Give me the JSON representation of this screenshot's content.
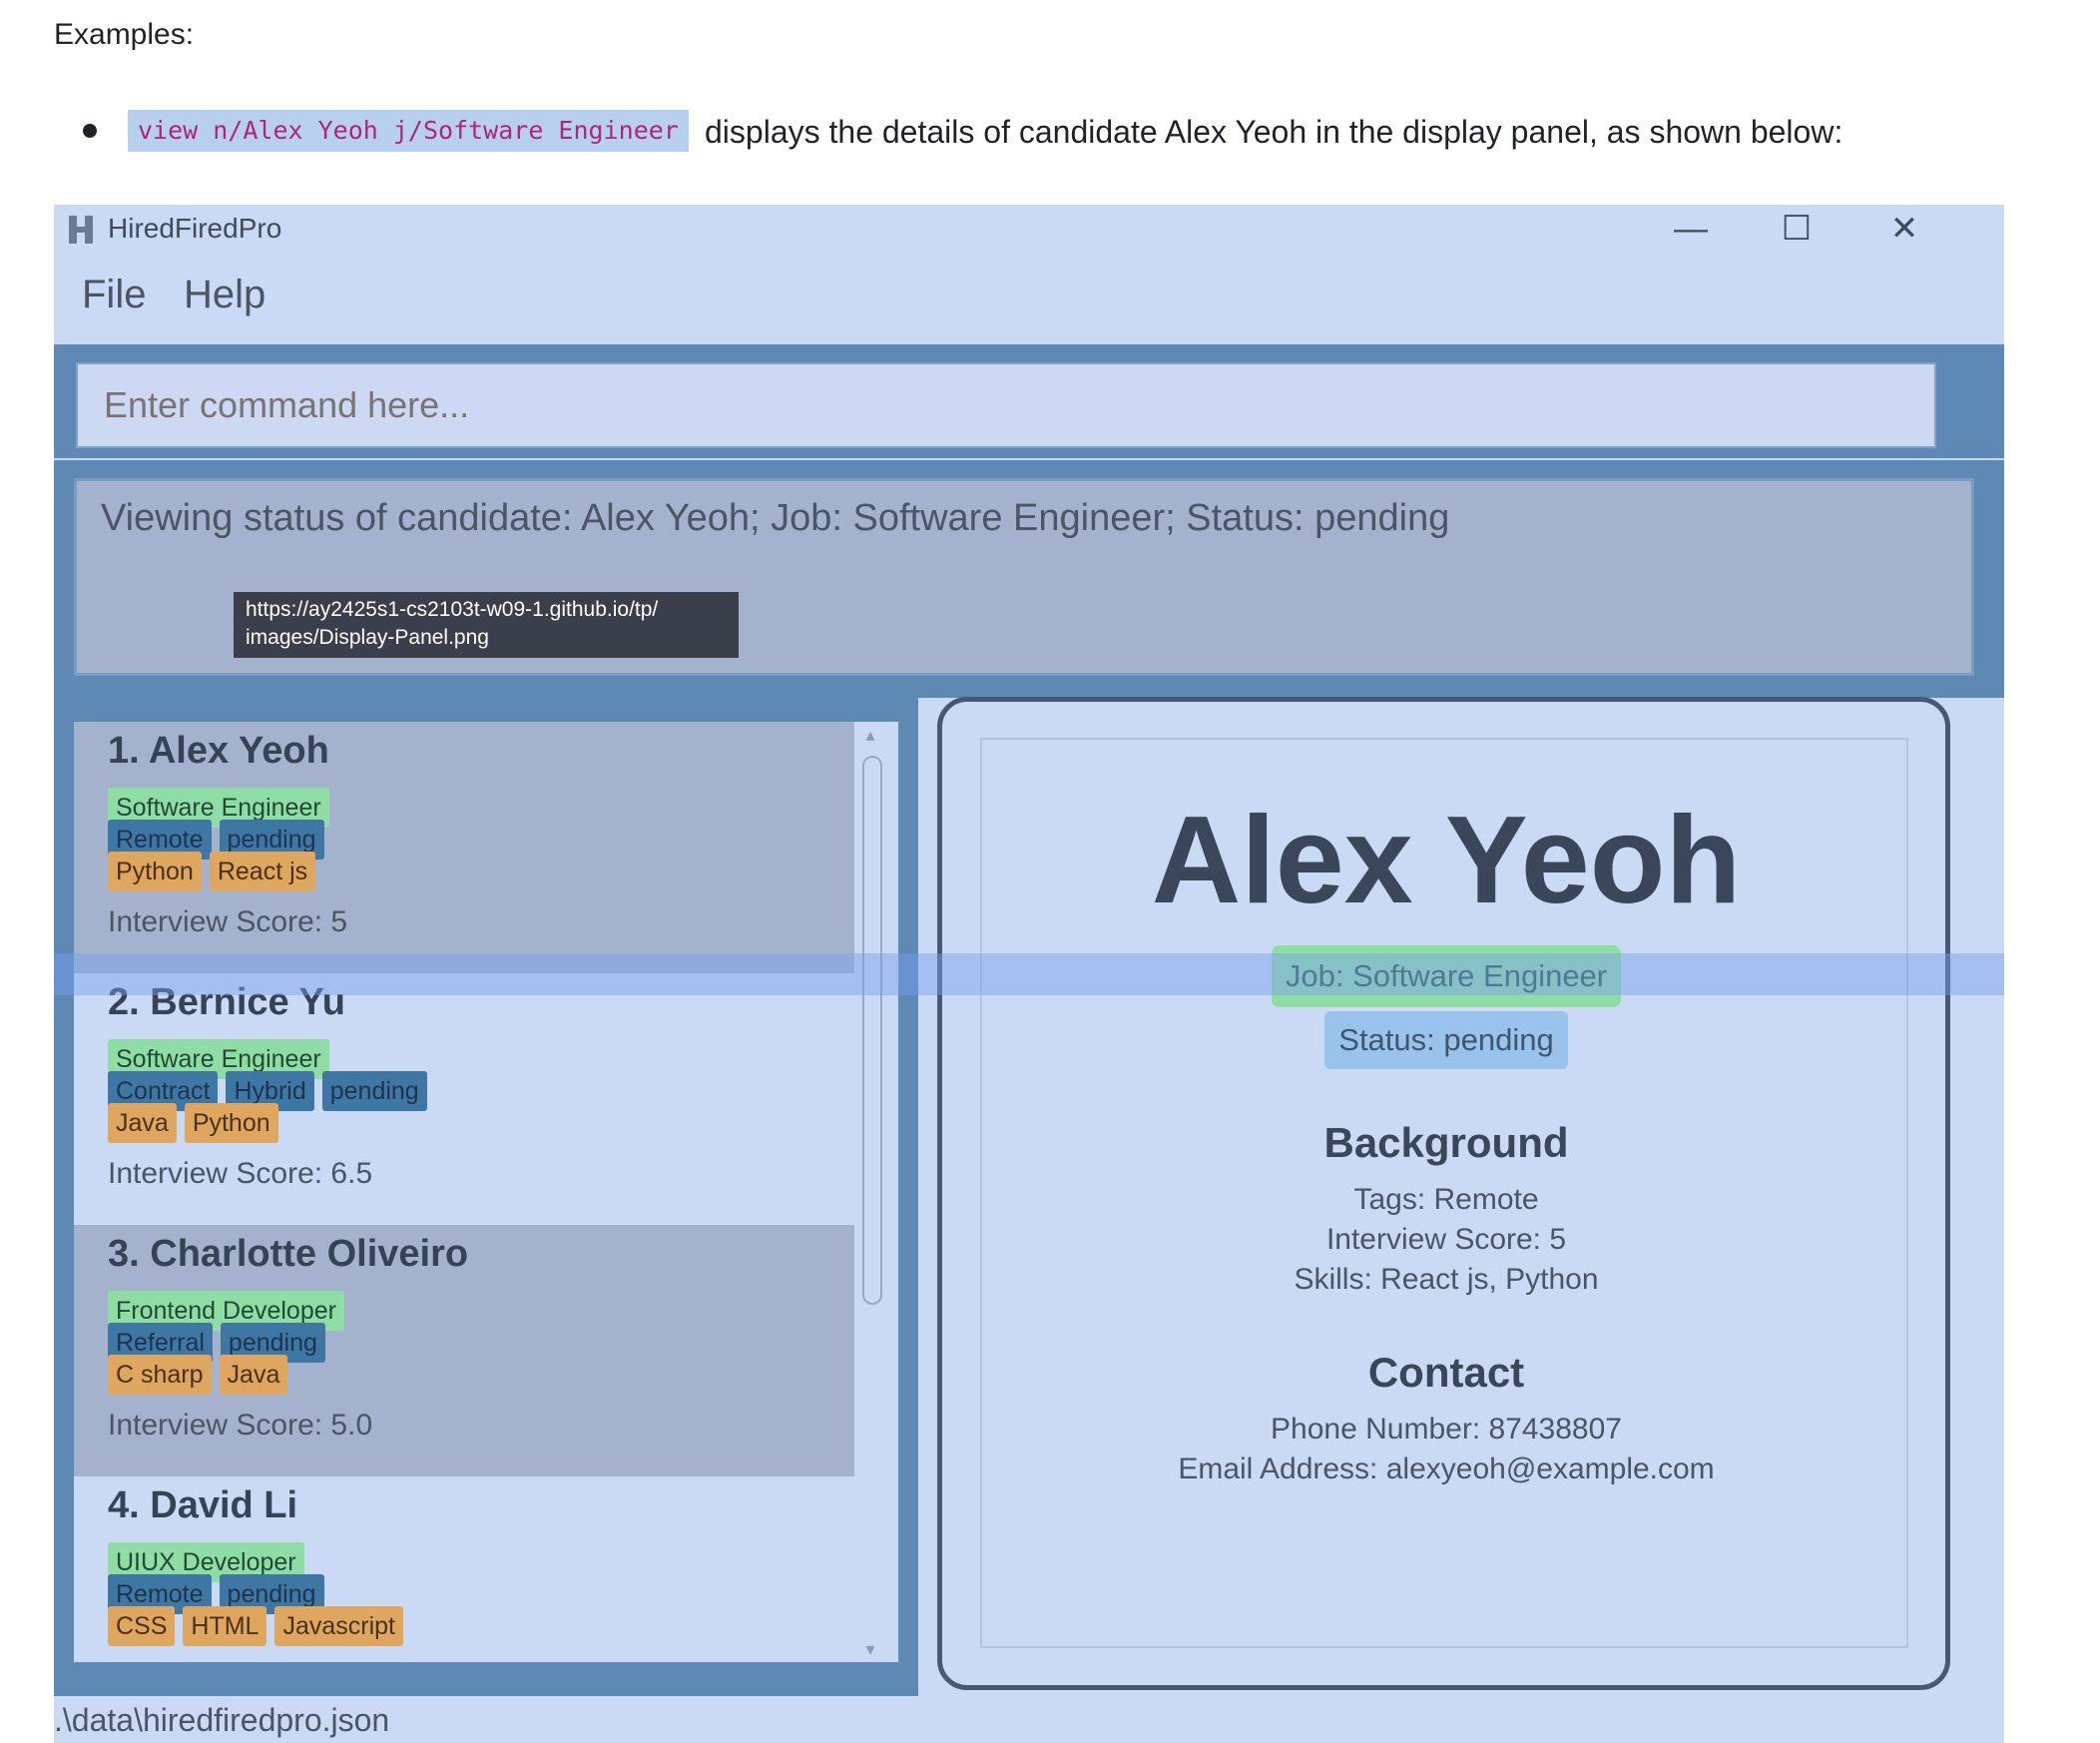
{
  "doc": {
    "heading": "Examples:",
    "code": "view n/Alex Yeoh j/Software Engineer",
    "sentence": "displays the details of candidate Alex Yeoh in the display panel, as shown below:"
  },
  "window": {
    "title": "HiredFiredPro",
    "minimize_glyph": "—",
    "maximize_glyph": "☐",
    "close_glyph": "✕"
  },
  "menu": {
    "file": "File",
    "help": "Help"
  },
  "command": {
    "placeholder": "Enter command here..."
  },
  "result": {
    "text": "Viewing status of candidate: Alex Yeoh; Job: Software Engineer; Status: pending"
  },
  "tooltip": {
    "line1": "https://ay2425s1-cs2103t-w09-1.github.io/tp/",
    "line2": "images/Display-Panel.png"
  },
  "candidates": [
    {
      "name": "1. Alex Yeoh",
      "job": "Software Engineer",
      "tags": [
        "Remote",
        "pending"
      ],
      "skills": [
        "Python",
        "React js"
      ],
      "score": "Interview Score: 5"
    },
    {
      "name": "2. Bernice Yu",
      "job": "Software Engineer",
      "tags": [
        "Contract",
        "Hybrid",
        "pending"
      ],
      "skills": [
        "Java",
        "Python"
      ],
      "score": "Interview Score: 6.5"
    },
    {
      "name": "3. Charlotte Oliveiro",
      "job": "Frontend Developer",
      "tags": [
        "Referral",
        "pending"
      ],
      "skills": [
        "C sharp",
        "Java"
      ],
      "score": "Interview Score: 5.0"
    },
    {
      "name": "4. David Li",
      "job": "UIUX Developer",
      "tags": [
        "Remote",
        "pending"
      ],
      "skills": [
        "CSS",
        "HTML",
        "Javascript"
      ],
      "score": ""
    }
  ],
  "display": {
    "name": "Alex Yeoh",
    "job": "Job: Software Engineer",
    "status": "Status: pending",
    "background_heading": "Background",
    "tags": "Tags: Remote",
    "score": "Interview Score: 5",
    "skills": "Skills: React js, Python",
    "contact_heading": "Contact",
    "phone": "Phone Number: 87438807",
    "email": "Email Address: alexyeoh@example.com"
  },
  "statusbar": {
    "path": ".\\data\\hiredfiredpro.json"
  },
  "colors": {
    "job_chip": "#90dca5",
    "tag_chip": "#3e76a4",
    "skill_chip": "#dfa660",
    "panel_border": "#5d89b4"
  }
}
